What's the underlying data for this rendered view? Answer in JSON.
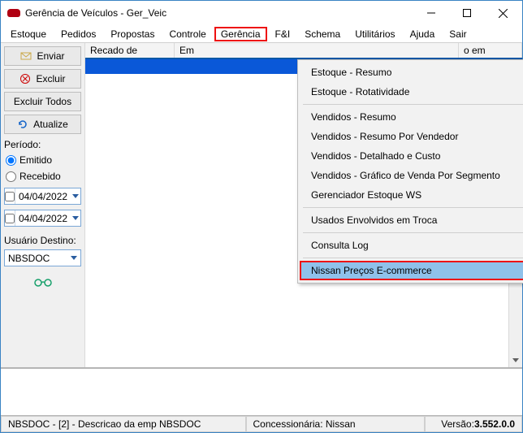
{
  "window": {
    "title": "Gerência de Veículos - Ger_Veic"
  },
  "menubar": {
    "items": [
      "Estoque",
      "Pedidos",
      "Propostas",
      "Controle",
      "Gerência",
      "F&I",
      "Schema",
      "Utilitários",
      "Ajuda",
      "Sair"
    ],
    "highlighted_index": 4
  },
  "sidebar": {
    "enviar": "Enviar",
    "excluir": "Excluir",
    "excluir_todos": "Excluir Todos",
    "atualize": "Atualize",
    "periodo_label": "Período:",
    "radio_emitido": "Emitido",
    "radio_recebido": "Recebido",
    "radio_selected": "emitido",
    "date1": "04/04/2022",
    "date2": "04/04/2022",
    "usuario_label": "Usuário Destino:",
    "usuario_value": "NBSDOC"
  },
  "grid": {
    "columns": [
      "Recado de",
      "Em",
      "o em"
    ]
  },
  "dropdown": {
    "groups": [
      [
        "Estoque - Resumo",
        "Estoque - Rotatividade"
      ],
      [
        "Vendidos - Resumo",
        "Vendidos - Resumo Por Vendedor",
        "Vendidos - Detalhado e Custo",
        "Vendidos - Gráfico de Venda Por Segmento",
        "Gerenciador Estoque WS"
      ],
      [
        "Usados Envolvidos em Troca"
      ],
      [
        "Consulta Log"
      ],
      [
        "Nissan Preços E-commerce"
      ]
    ],
    "highlighted": "Nissan Preços E-commerce"
  },
  "status": {
    "left": "NBSDOC - [2] - Descricao da emp  NBSDOC",
    "center": "Concessionária: Nissan",
    "right_label": "Versão: ",
    "right_value": "3.552.0.0"
  }
}
